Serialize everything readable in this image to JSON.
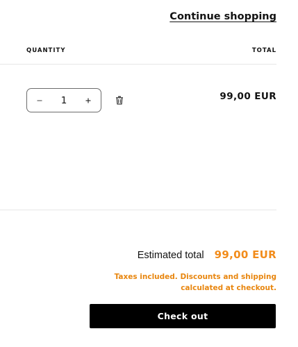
{
  "header": {
    "continue_shopping_label": "Continue shopping"
  },
  "table_headers": {
    "quantity": "QUANTITY",
    "total": "TOTAL"
  },
  "line_item": {
    "quantity": "1",
    "total": "99,00 EUR",
    "decrease_icon": "minus-icon",
    "increase_icon": "plus-icon",
    "remove_icon": "trash-icon"
  },
  "summary": {
    "estimated_total_label": "Estimated total",
    "estimated_total_value": "99,00 EUR",
    "tax_note": "Taxes included. Discounts and shipping calculated at checkout.",
    "checkout_label": "Check out"
  },
  "colors": {
    "accent_orange": "#f28c1b",
    "button_black": "#000000",
    "text_dark": "#121212"
  }
}
